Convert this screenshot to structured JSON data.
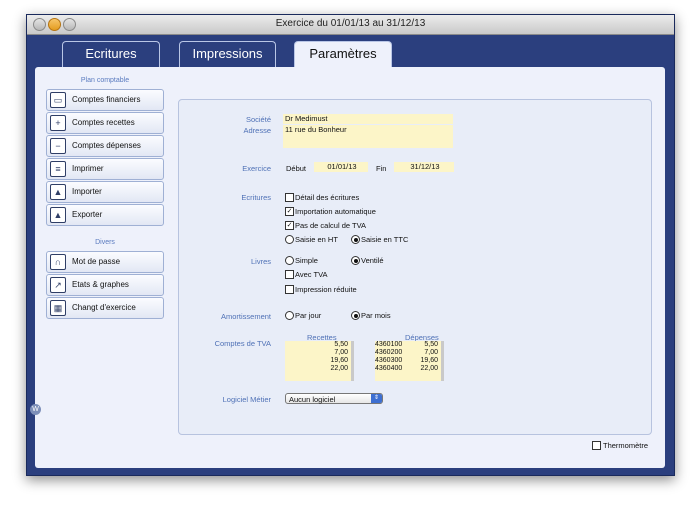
{
  "window": {
    "title": "Exercice du 01/01/13 au 31/12/13"
  },
  "tabs": {
    "ecritures": "Ecritures",
    "impressions": "Impressions",
    "parametres": "Paramètres"
  },
  "sidebar": {
    "plan_title": "Plan comptable",
    "plan_items": [
      {
        "label": "Comptes financiers",
        "icon": "bank-icon"
      },
      {
        "label": "Comptes recettes",
        "icon": "plus-doc-icon"
      },
      {
        "label": "Comptes dépenses",
        "icon": "minus-doc-icon"
      },
      {
        "label": "Imprimer",
        "icon": "printer-icon"
      },
      {
        "label": "Importer",
        "icon": "import-icon"
      },
      {
        "label": "Exporter",
        "icon": "export-icon"
      }
    ],
    "divers_title": "Divers",
    "divers_items": [
      {
        "label": "Mot de passe",
        "icon": "lock-icon"
      },
      {
        "label": "Etats & graphes",
        "icon": "chart-icon"
      },
      {
        "label": "Changt d'exercice",
        "icon": "calendar-icon"
      }
    ]
  },
  "form": {
    "societe_label": "Société",
    "societe_value": "Dr Medimust",
    "adresse_label": "Adresse",
    "adresse_value": "11 rue du Bonheur",
    "exercice_label": "Exercice",
    "debut_label": "Début",
    "debut_value": "01/01/13",
    "fin_label": "Fin",
    "fin_value": "31/12/13",
    "ecritures_label": "Ecritures",
    "detail_ecritures": "Détail des écritures",
    "detail_checked": false,
    "importation_auto": "Importation automatique",
    "importation_checked": true,
    "pas_calcul_tva": "Pas de calcul de TVA",
    "pas_calcul_checked": true,
    "saisie_ht": "Saisie en HT",
    "saisie_ttc": "Saisie en TTC",
    "saisie_selected": "TTC",
    "livres_label": "Livres",
    "simple": "Simple",
    "ventile": "Ventilé",
    "livres_selected": "Ventilé",
    "avec_tva": "Avec TVA",
    "avec_tva_checked": false,
    "impression_reduite": "Impression réduite",
    "impression_reduite_checked": false,
    "amortissement_label": "Amortissement",
    "par_jour": "Par jour",
    "par_mois": "Par mois",
    "amortissement_selected": "Par mois",
    "comptes_tva_label": "Comptes de TVA",
    "recettes_title": "Recettes",
    "recettes": [
      "5,50",
      "7,00",
      "19,60",
      "22,00"
    ],
    "depenses_title": "Dépenses",
    "depenses": [
      {
        "compte": "4360100",
        "taux": "5,50"
      },
      {
        "compte": "4360200",
        "taux": "7,00"
      },
      {
        "compte": "4360300",
        "taux": "19,60"
      },
      {
        "compte": "4360400",
        "taux": "22,00"
      }
    ],
    "logiciel_label": "Logiciel Métier",
    "logiciel_value": "Aucun logiciel"
  },
  "footer": {
    "thermometre": "Thermomètre",
    "thermometre_checked": false,
    "badge": "W"
  },
  "colors": {
    "window_bg": "#2b3f7e",
    "content_bg": "#eef1fb",
    "field_bg": "#fcf5c8",
    "label_blue": "#4f71b6"
  }
}
